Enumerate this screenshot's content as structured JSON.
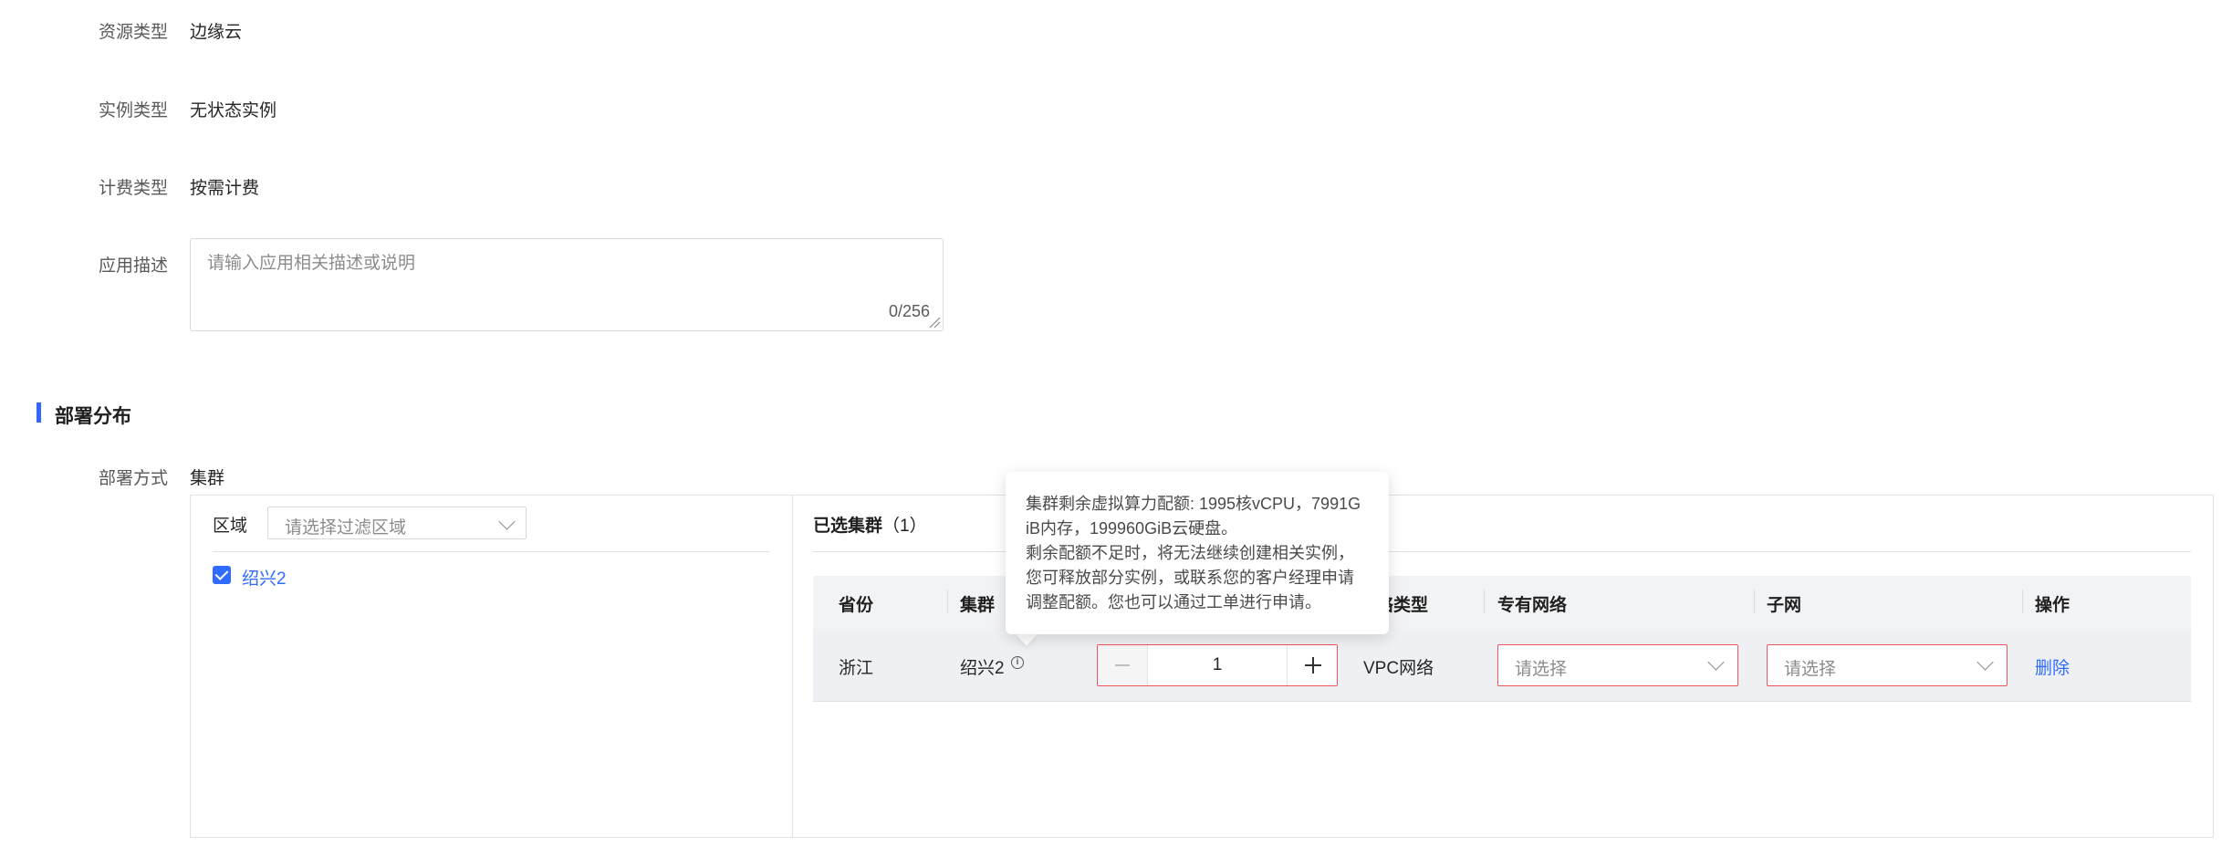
{
  "form": {
    "resource_type": {
      "label": "资源类型",
      "value": "边缘云"
    },
    "instance_type": {
      "label": "实例类型",
      "value": "无状态实例"
    },
    "billing_type": {
      "label": "计费类型",
      "value": "按需计费"
    },
    "description": {
      "label": "应用描述",
      "placeholder": "请输入应用相关描述或说明",
      "counter": "0/256"
    }
  },
  "deploy": {
    "section_title": "部署分布",
    "method_label": "部署方式",
    "method_value": "集群",
    "region_label": "区域",
    "region_placeholder": "请选择过滤区域",
    "clusters": [
      {
        "name": "绍兴2",
        "checked": true
      }
    ],
    "selected_title": "已选集群",
    "selected_count": "（1）",
    "table": {
      "headers": {
        "province": "省份",
        "cluster": "集群",
        "network_type": "络类型",
        "private_network": "专有网络",
        "subnet": "子网",
        "actions": "操作"
      },
      "rows": [
        {
          "province": "浙江",
          "cluster": "绍兴2",
          "quantity": "1",
          "network_type": "VPC网络",
          "private_network_placeholder": "请选择",
          "subnet_placeholder": "请选择",
          "action": "删除"
        }
      ]
    },
    "tooltip": {
      "line1": "集群剩余虚拟算力配额: 1995核vCPU，7991G",
      "line2": "iB内存，199960GiB云硬盘。",
      "line3": "剩余配额不足时，将无法继续创建相关实例，",
      "line4": "您可释放部分实例，或联系您的客户经理申请",
      "line5": "调整配额。您也可以通过工单进行申请。"
    }
  },
  "colors": {
    "accent": "#2f6bff",
    "section_bar": "#3366ff",
    "error_border": "#f2535d"
  }
}
